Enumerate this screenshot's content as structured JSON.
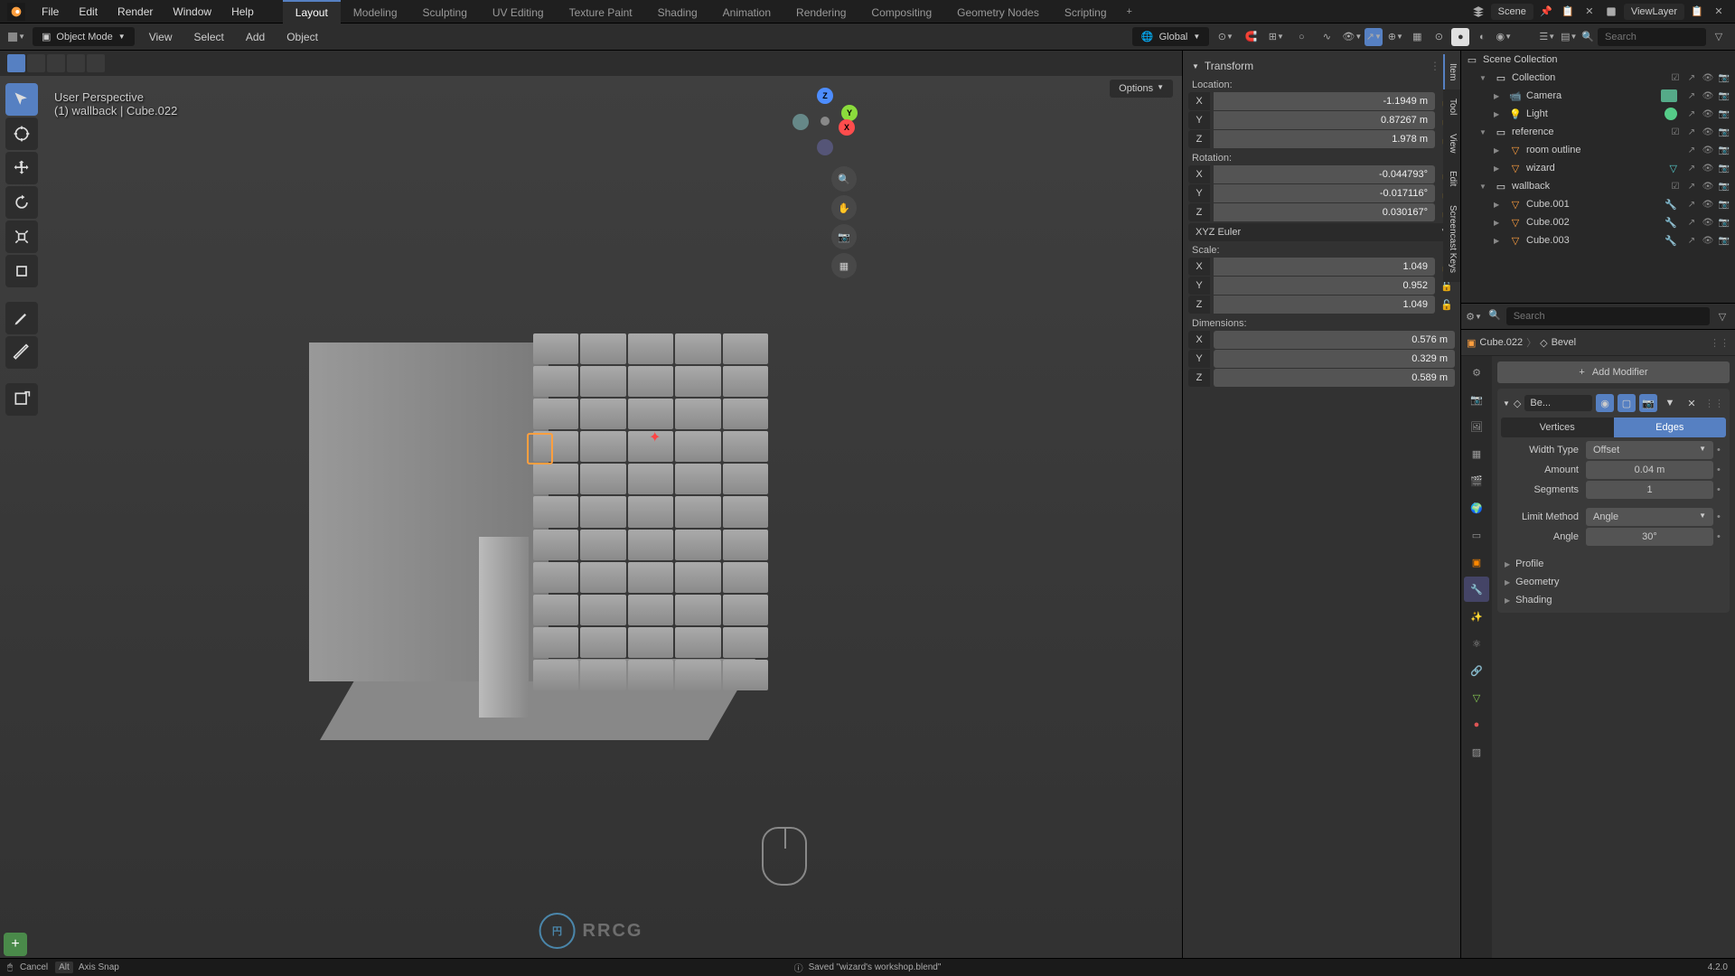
{
  "top_menu": {
    "items": [
      "File",
      "Edit",
      "Render",
      "Window",
      "Help"
    ]
  },
  "workspaces": {
    "tabs": [
      "Layout",
      "Modeling",
      "Sculpting",
      "UV Editing",
      "Texture Paint",
      "Shading",
      "Animation",
      "Rendering",
      "Compositing",
      "Geometry Nodes",
      "Scripting"
    ],
    "active": "Layout"
  },
  "scene": {
    "scene_label": "Scene",
    "viewlayer_label": "ViewLayer"
  },
  "viewport_header": {
    "mode": "Object Mode",
    "menus": [
      "View",
      "Select",
      "Add",
      "Object"
    ],
    "orientation": "Global",
    "search_placeholder": "Search",
    "options_label": "Options"
  },
  "viewport_info": {
    "line1": "User Perspective",
    "line2": "(1) wallback | Cube.022"
  },
  "gizmo": {
    "x": "X",
    "y": "Y",
    "z": "Z"
  },
  "transform_panel": {
    "title": "Transform",
    "location_label": "Location:",
    "location": {
      "x": "-1.1949 m",
      "y": "0.87267 m",
      "z": "1.978 m"
    },
    "rotation_label": "Rotation:",
    "rotation": {
      "x": "-0.044793°",
      "y": "-0.017116°",
      "z": "0.030167°"
    },
    "rotation_mode": "XYZ Euler",
    "scale_label": "Scale:",
    "scale": {
      "x": "1.049",
      "y": "0.952",
      "z": "1.049"
    },
    "dimensions_label": "Dimensions:",
    "dimensions": {
      "x": "0.576 m",
      "y": "0.329 m",
      "z": "0.589 m"
    },
    "axis": {
      "x": "X",
      "y": "Y",
      "z": "Z"
    }
  },
  "n_panel_tabs": [
    "Item",
    "Tool",
    "View",
    "Edit",
    "Screencast Keys"
  ],
  "outliner": {
    "scene_collection": "Scene Collection",
    "search_placeholder": "Search",
    "items": [
      {
        "name": "Collection",
        "type": "collection",
        "indent": 1,
        "expanded": true
      },
      {
        "name": "Camera",
        "type": "camera",
        "indent": 2
      },
      {
        "name": "Light",
        "type": "light",
        "indent": 2
      },
      {
        "name": "reference",
        "type": "collection",
        "indent": 1,
        "expanded": true
      },
      {
        "name": "room outline",
        "type": "mesh",
        "indent": 2
      },
      {
        "name": "wizard",
        "type": "mesh",
        "indent": 2
      },
      {
        "name": "wallback",
        "type": "collection",
        "indent": 1,
        "expanded": true
      },
      {
        "name": "Cube.001",
        "type": "mesh",
        "indent": 2
      },
      {
        "name": "Cube.002",
        "type": "mesh",
        "indent": 2
      },
      {
        "name": "Cube.003",
        "type": "mesh",
        "indent": 2
      }
    ]
  },
  "properties": {
    "search_placeholder": "Search",
    "breadcrumb_obj": "Cube.022",
    "breadcrumb_mod": "Bevel",
    "add_modifier": "Add Modifier",
    "modifier_name": "Be...",
    "bevel": {
      "tab_vertices": "Vertices",
      "tab_edges": "Edges",
      "width_type_label": "Width Type",
      "width_type": "Offset",
      "amount_label": "Amount",
      "amount": "0.04 m",
      "segments_label": "Segments",
      "segments": "1",
      "limit_method_label": "Limit Method",
      "limit_method": "Angle",
      "angle_label": "Angle",
      "angle": "30°",
      "profile": "Profile",
      "geometry": "Geometry",
      "shading": "Shading"
    }
  },
  "status": {
    "cancel": "Cancel",
    "alt": "Alt",
    "axis_snap": "Axis Snap",
    "saved_msg": "Saved \"wizard's workshop.blend\"",
    "version": "4.2.0"
  },
  "watermark": "RRCG"
}
